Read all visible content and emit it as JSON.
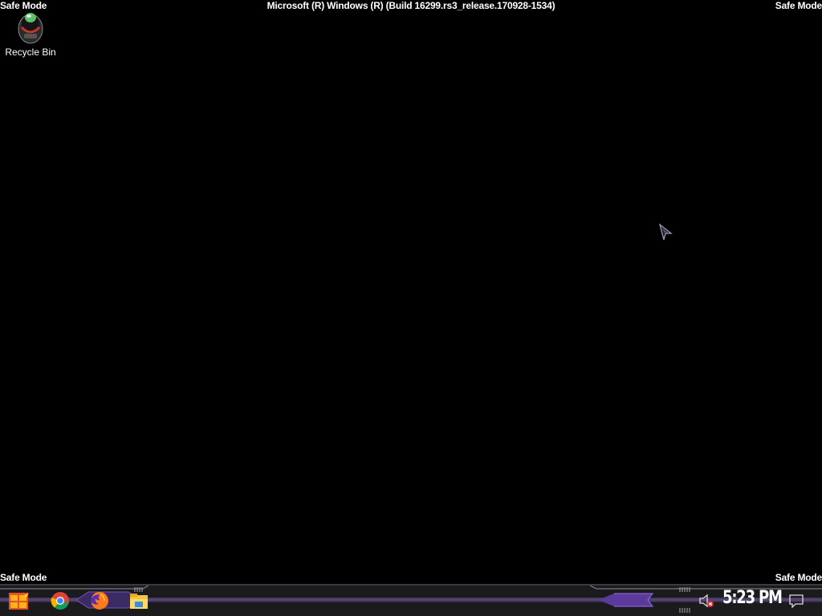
{
  "watermarks": {
    "safe_mode_label": "Safe Mode",
    "build_title": "Microsoft (R) Windows (R) (Build 16299.rs3_release.170928-1534)"
  },
  "desktop": {
    "icons": [
      {
        "label": "Recycle Bin",
        "icon": "recycle-bin-icon"
      }
    ]
  },
  "taskbar": {
    "apps": [
      {
        "name": "start",
        "icon": "start-icon"
      },
      {
        "name": "google-chrome",
        "icon": "chrome-icon"
      },
      {
        "name": "firefox",
        "icon": "firefox-icon"
      },
      {
        "name": "file-explorer",
        "icon": "folder-icon"
      }
    ],
    "tray": {
      "volume_icon": "volume-muted-icon",
      "clock": "5:23 PM",
      "notification_icon": "action-center-icon"
    }
  },
  "colors": {
    "desktop_bg": "#000000",
    "taskbar_bg": "#1b1b1d",
    "accent_purple": "#7a4fc4"
  }
}
